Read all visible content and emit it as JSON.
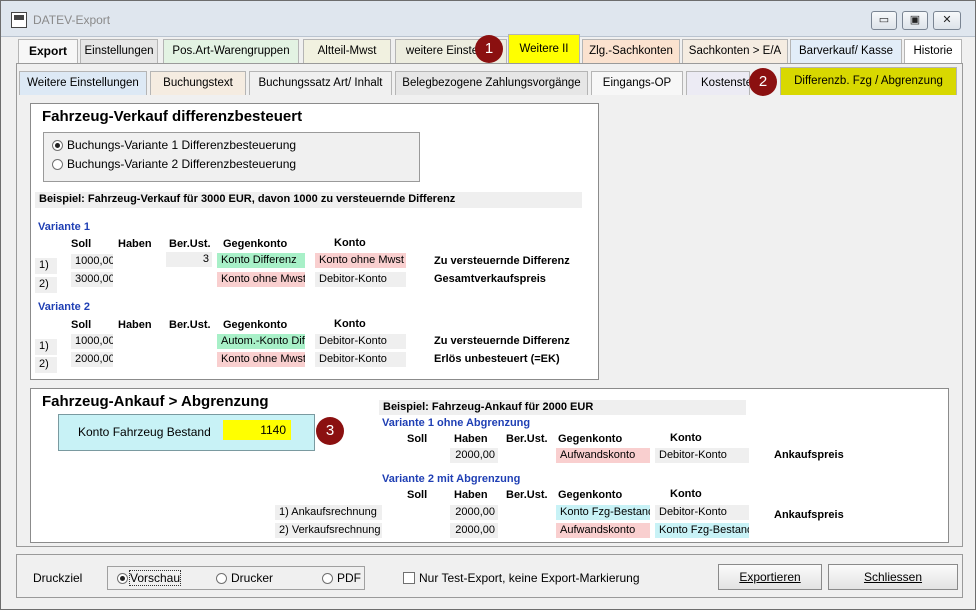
{
  "window": {
    "title": "DATEV-Export",
    "minimize": "▭",
    "restore": "▣",
    "close": "✕"
  },
  "main_tabs": [
    {
      "label": "Export"
    },
    {
      "label": "Einstellungen"
    },
    {
      "label": "Pos.Art-Warengruppen"
    },
    {
      "label": "Altteil-Mwst"
    },
    {
      "label": "weitere Einstellun"
    },
    {
      "label": "Weitere II"
    },
    {
      "label": "Zlg.-Sachkonten"
    },
    {
      "label": "Sachkonten > E/A"
    },
    {
      "label": "Barverkauf/ Kasse"
    },
    {
      "label": "Historie"
    }
  ],
  "sub_tabs": [
    {
      "label": "Weitere Einstellungen"
    },
    {
      "label": "Buchungstext"
    },
    {
      "label": "Buchungssatz Art/ Inhalt"
    },
    {
      "label": "Belegbezogene Zahlungsvorgänge"
    },
    {
      "label": "Eingangs-OP"
    },
    {
      "label": "Kostenste"
    },
    {
      "label": "Differenzb. Fzg / Abgrenzung"
    }
  ],
  "badges": [
    "1",
    "2",
    "3"
  ],
  "verkauf": {
    "title": "Fahrzeug-Verkauf differenzbesteuert",
    "option1": "Buchungs-Variante 1 Differenzbesteuerung",
    "option2": "Buchungs-Variante 2 Differenzbesteuerung",
    "example": "Beispiel: Fahrzeug-Verkauf für 3000 EUR, davon 1000 zu versteuernde Differenz",
    "headers": {
      "soll": "Soll",
      "haben": "Haben",
      "berust": "Ber.Ust.",
      "gegenkonto": "Gegenkonto",
      "konto": "Konto"
    },
    "variante1": {
      "label": "Variante 1",
      "rows": [
        {
          "num": "1)",
          "soll": "1000,00",
          "berust": "3",
          "gegenkonto": "Konto Differenz",
          "konto": "Konto ohne Mwst",
          "desc": "Zu versteuernde Differenz"
        },
        {
          "num": "2)",
          "soll": "3000,00",
          "gegenkonto": "Konto ohne Mwst",
          "konto": "Debitor-Konto",
          "desc": "Gesamtverkaufspreis"
        }
      ]
    },
    "variante2": {
      "label": "Variante 2",
      "rows": [
        {
          "num": "1)",
          "soll": "1000,00",
          "gegenkonto": "Autom.-Konto Diffe",
          "konto": "Debitor-Konto",
          "desc": "Zu versteuernde Differenz"
        },
        {
          "num": "2)",
          "soll": "2000,00",
          "gegenkonto": "Konto ohne Mwst",
          "konto": "Debitor-Konto",
          "desc": "Erlös unbesteuert (=EK)"
        }
      ]
    }
  },
  "ankauf": {
    "title": "Fahrzeug-Ankauf > Abgrenzung",
    "bestand_label": "Konto Fahrzeug Bestand",
    "bestand_value": "1140",
    "example": "Beispiel: Fahrzeug-Ankauf für 2000 EUR",
    "variante1": {
      "label": "Variante 1 ohne Abgrenzung",
      "row": {
        "haben": "2000,00",
        "gegenkonto": "Aufwandskonto",
        "konto": "Debitor-Konto",
        "desc": "Ankaufspreis"
      }
    },
    "variante2": {
      "label": "Variante 2 mit Abgrenzung",
      "rows": [
        {
          "label": "1) Ankaufsrechnung",
          "haben": "2000,00",
          "gegenkonto": "Konto Fzg-Bestand",
          "konto": "Debitor-Konto"
        },
        {
          "label": "2) Verkaufsrechnung",
          "haben": "2000,00",
          "gegenkonto": "Aufwandskonto",
          "konto": "Konto Fzg-Bestand"
        }
      ],
      "desc": "Ankaufspreis"
    }
  },
  "footer": {
    "druckziel": "Druckziel",
    "vorschau": "Vorschau",
    "drucker": "Drucker",
    "pdf": "PDF",
    "test_export": "Nur Test-Export, keine Export-Markierung",
    "exportieren": "Exportieren",
    "schliessen": "Schliessen"
  },
  "colors": {
    "weitere_ii": "#ffff00",
    "differenzb": "#d8d800",
    "bestand_field": "#ffff00",
    "badge": "#8b1010"
  }
}
